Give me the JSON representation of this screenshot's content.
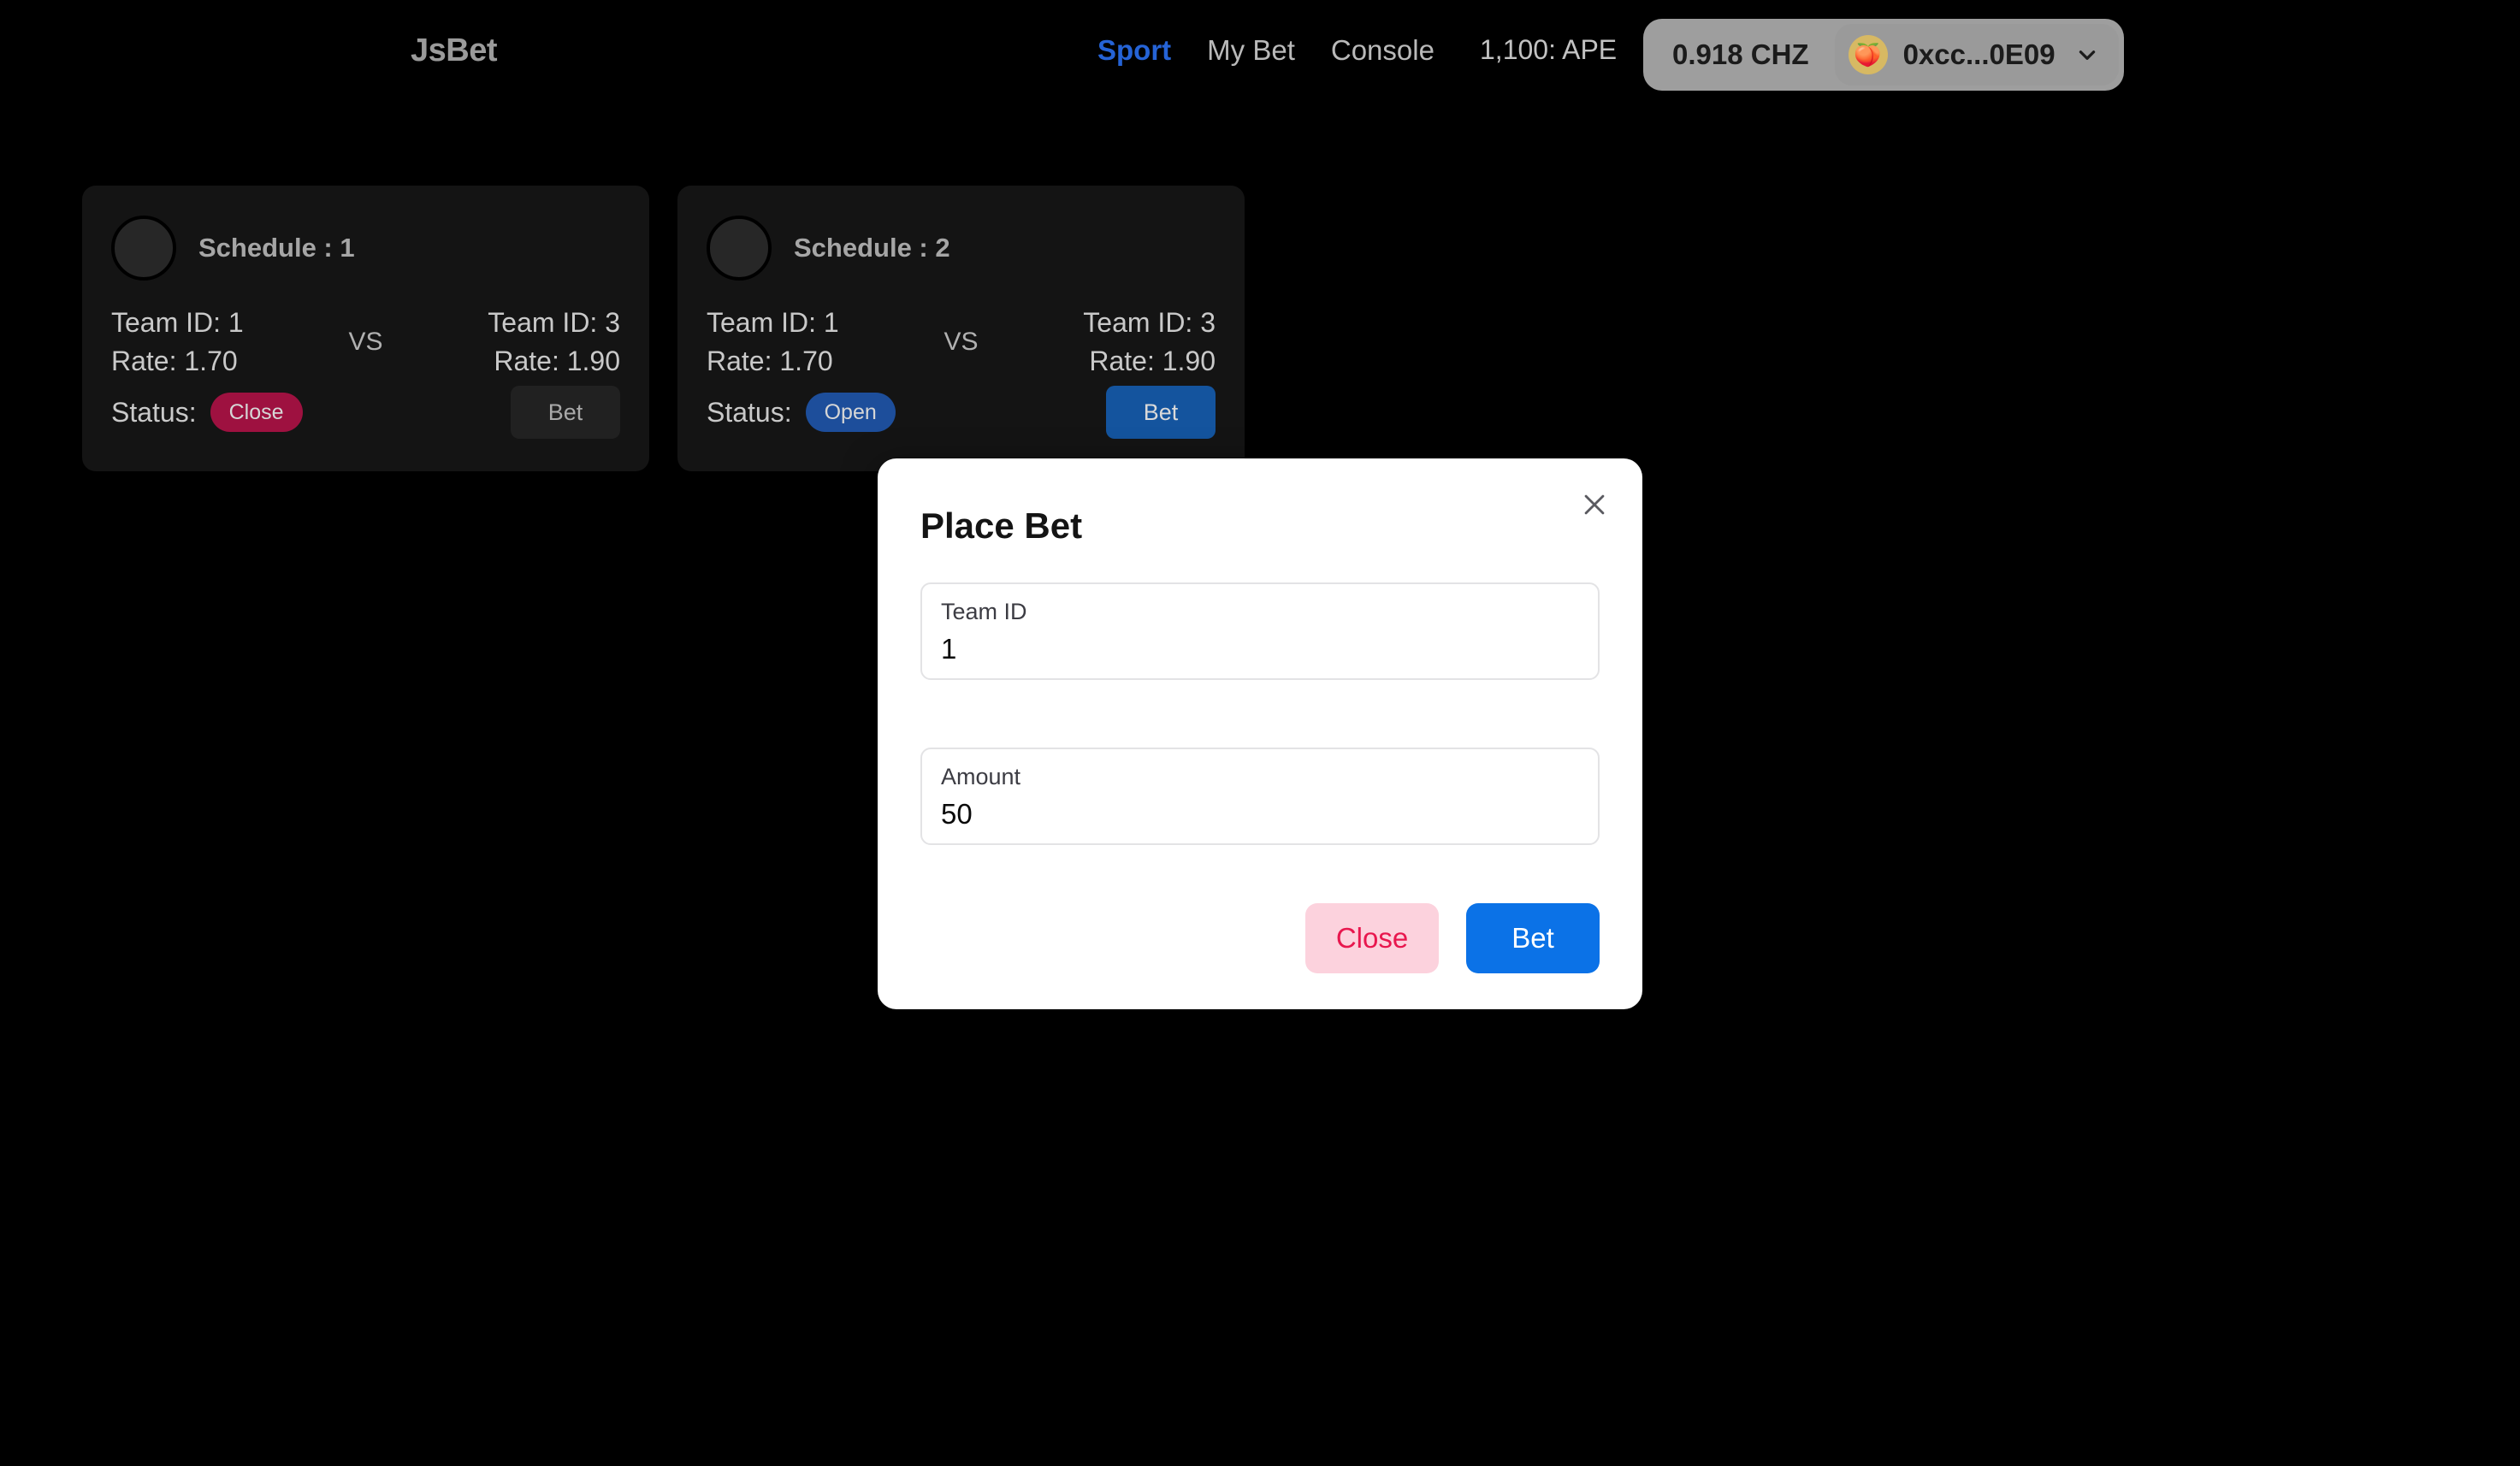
{
  "navbar": {
    "brand": "JsBet",
    "links": [
      {
        "label": "Sport",
        "active": true
      },
      {
        "label": "My Bet",
        "active": false
      },
      {
        "label": "Console",
        "active": false
      }
    ],
    "balance": "1,100: APE",
    "wallet": {
      "token_balance": "0.918 CHZ",
      "address": "0xcc...0E09",
      "avatar_emoji": "🍑",
      "chevron_icon": "chevron-down-icon"
    },
    "active_color": "#2563d6"
  },
  "cards": [
    {
      "title": "Schedule : 1",
      "home": {
        "team": "Team ID: 1",
        "rate": "Rate: 1.70"
      },
      "away": {
        "team": "Team ID: 3",
        "rate": "Rate: 1.90"
      },
      "vs": "VS",
      "status_label": "Status:",
      "status_value": "Close",
      "status_color": "#9e1140",
      "bet_label": "Bet",
      "bet_enabled": false
    },
    {
      "title": "Schedule : 2",
      "home": {
        "team": "Team ID: 1",
        "rate": "Rate: 1.70"
      },
      "away": {
        "team": "Team ID: 3",
        "rate": "Rate: 1.90"
      },
      "vs": "VS",
      "status_label": "Status:",
      "status_value": "Open",
      "status_color": "#1d4e9b",
      "bet_label": "Bet",
      "bet_enabled": true
    }
  ],
  "modal": {
    "title": "Place Bet",
    "close_icon": "close-icon",
    "fields": [
      {
        "label": "Team ID",
        "value": "1",
        "placeholder": "Team ID"
      },
      {
        "label": "Amount",
        "value": "50",
        "placeholder": "Amount"
      }
    ],
    "actions": {
      "close_label": "Close",
      "bet_label": "Bet",
      "close_color": "#e8174e",
      "bet_color": "#0b72e7"
    }
  }
}
